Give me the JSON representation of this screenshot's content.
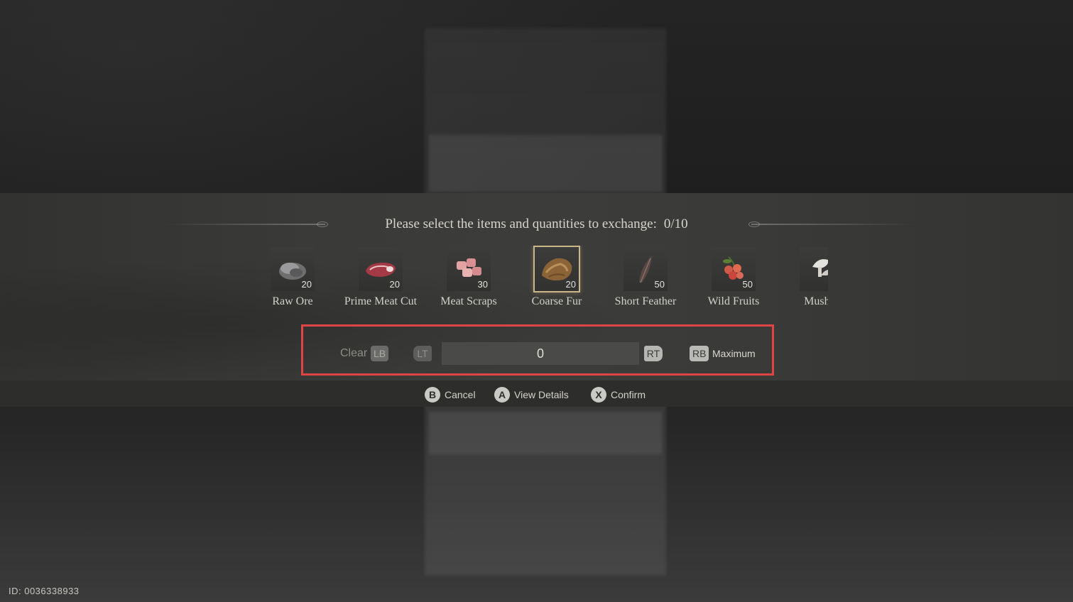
{
  "dialog": {
    "prompt": "Please select the items and quantities to exchange:",
    "count": "0/10"
  },
  "items": [
    {
      "name": "Raw Ore",
      "qty": "20",
      "icon": "raw-ore-icon",
      "selected": false
    },
    {
      "name": "Prime Meat Cut",
      "qty": "20",
      "icon": "prime-meat-cut-icon",
      "selected": false
    },
    {
      "name": "Meat Scraps",
      "qty": "30",
      "icon": "meat-scraps-icon",
      "selected": false
    },
    {
      "name": "Coarse Fur",
      "qty": "20",
      "icon": "coarse-fur-icon",
      "selected": true
    },
    {
      "name": "Short Feather",
      "qty": "50",
      "icon": "short-feather-icon",
      "selected": false
    },
    {
      "name": "Wild Fruits",
      "qty": "50",
      "icon": "wild-fruits-icon",
      "selected": false
    },
    {
      "name": "Mushro",
      "qty": "",
      "icon": "mushroom-icon",
      "selected": false
    }
  ],
  "controls": {
    "clear_label": "Clear",
    "clear_button": "LB",
    "decrease_button": "LT",
    "quantity_value": "0",
    "increase_button": "RT",
    "max_button": "RB",
    "max_label": "Maximum",
    "highlight_color": "#e04444"
  },
  "hints": [
    {
      "button": "B",
      "label": "Cancel"
    },
    {
      "button": "A",
      "label": "View Details"
    },
    {
      "button": "X",
      "label": "Confirm"
    }
  ],
  "footer": {
    "id_text": "ID: 0036338933"
  }
}
